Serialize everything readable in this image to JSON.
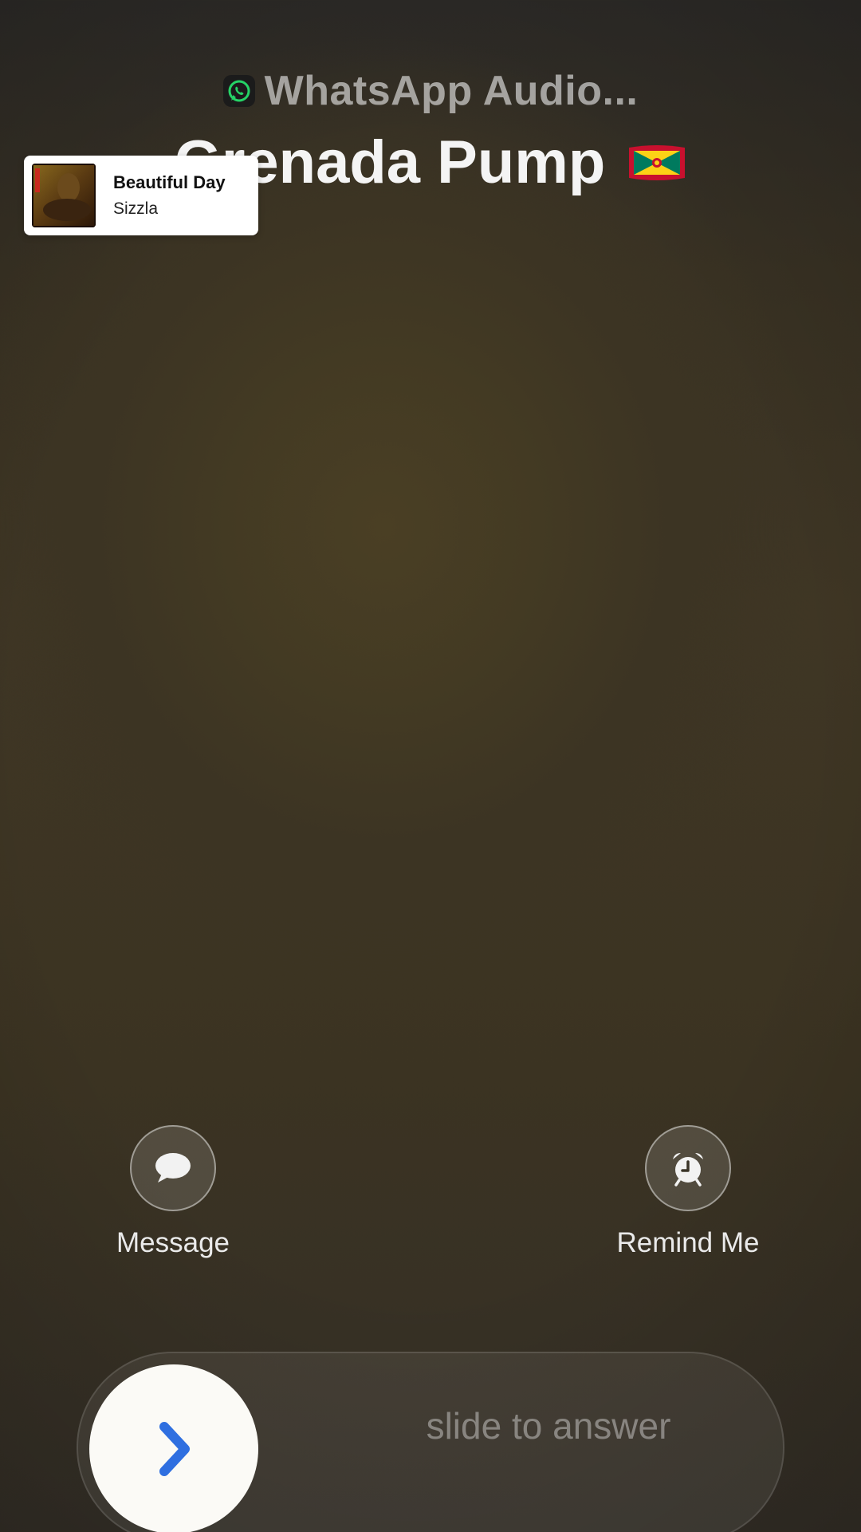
{
  "call": {
    "source_app": "WhatsApp Audio...",
    "source_icon": "whatsapp-icon",
    "caller_name": "Grenada Pump",
    "caller_flag": "grenada-flag"
  },
  "now_playing": {
    "title": "Beautiful Day",
    "artist": "Sizzla",
    "album_art": "album-art"
  },
  "actions": {
    "message_label": "Message",
    "message_icon": "message-bubble-icon",
    "remind_label": "Remind Me",
    "remind_icon": "alarm-clock-icon"
  },
  "slider": {
    "label": "slide to answer",
    "knob_icon": "chevron-right-icon",
    "knob_icon_color": "#2f6fe0"
  },
  "colors": {
    "background": "#3d3524",
    "accent": "#2f6fe0",
    "whatsapp_green": "#25d366"
  }
}
